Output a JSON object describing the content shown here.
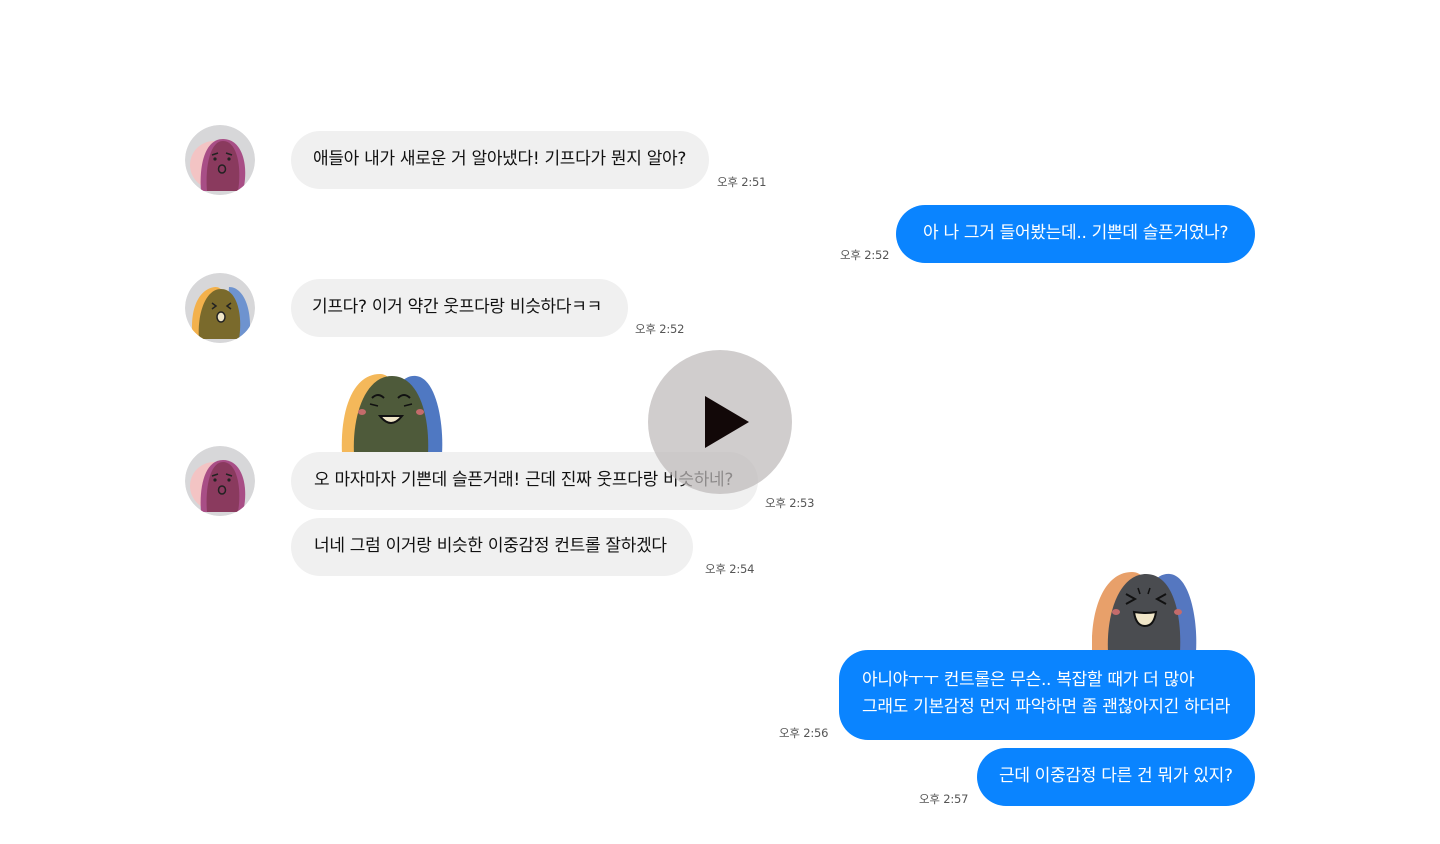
{
  "colors": {
    "outgoing": "#0a84ff",
    "incoming": "#f0f0f0",
    "text_dark": "#111111",
    "text_light": "#ffffff"
  },
  "messages": [
    {
      "side": "in",
      "text": "애들아 내가 새로운 거 알아냈다! 기프다가 뭔지 알아?",
      "time": "오후 2:51"
    },
    {
      "side": "out",
      "text": "아 나 그거 들어봤는데.. 기쁜데 슬픈거였나?",
      "time": "오후 2:52"
    },
    {
      "side": "in",
      "text": "기프다? 이거 약간 웃프다랑 비슷하다ㅋㅋ",
      "time": "오후 2:52"
    },
    {
      "side": "in",
      "text": "오 마자마자 기쁜데 슬픈거래! 근데 진짜 웃프다랑 비슷하네?",
      "time": "오후 2:53"
    },
    {
      "side": "in",
      "text": "너네 그럼 이거랑 비슷한 이중감정 컨트롤 잘하겠다",
      "time": "오후 2:54"
    },
    {
      "side": "out",
      "lines": [
        "아니야ㅜㅜ 컨트롤은 무슨.. 복잡할 때가 더 많아",
        "그래도 기본감정 먼저 파악하면 좀 괜찮아지긴 하더라"
      ],
      "time": "오후 2:56"
    },
    {
      "side": "out",
      "text": "근데 이중감정 다른 건 뭐가 있지?",
      "time": "오후 2:57"
    }
  ],
  "icons": {
    "avatar_1": "purple-character-avatar-icon",
    "avatar_2": "olive-character-avatar-icon",
    "avatar_3": "purple-character-avatar-icon",
    "sticker_1": "laughing-green-character-sticker-icon",
    "sticker_2": "squinting-gray-character-sticker-icon",
    "play": "play-icon"
  }
}
